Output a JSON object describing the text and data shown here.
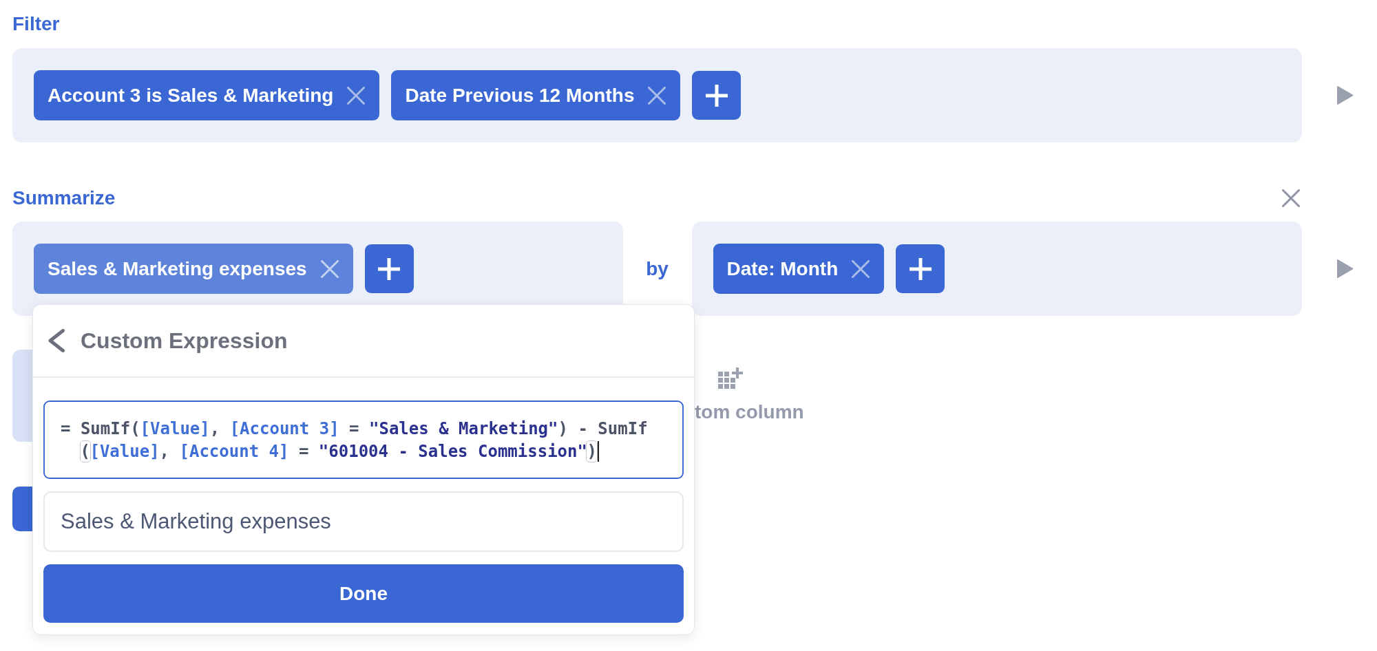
{
  "filter": {
    "title": "Filter",
    "chips": [
      {
        "label": "Account 3 is Sales & Marketing",
        "selected": false
      },
      {
        "label": "Date Previous 12 Months",
        "selected": false
      }
    ]
  },
  "summarize": {
    "title": "Summarize",
    "metrics": [
      {
        "label": "Sales & Marketing expenses",
        "selected": true
      }
    ],
    "by": "by",
    "breakouts": [
      {
        "label": "Date: Month",
        "selected": false
      }
    ]
  },
  "actions": {
    "custom_column": {
      "label": "tom column"
    }
  },
  "popup": {
    "title": "Custom Expression",
    "expression": {
      "focused": true,
      "cursor": true,
      "lines": [
        {
          "tokens": [
            {
              "text": "= ",
              "kind": "operator"
            },
            {
              "text": "SumIf",
              "kind": "function"
            },
            {
              "text": "(",
              "kind": "punct"
            },
            {
              "text": "[Value]",
              "kind": "field"
            },
            {
              "text": ", ",
              "kind": "punct"
            },
            {
              "text": "[Account 3]",
              "kind": "field"
            },
            {
              "text": " = ",
              "kind": "operator"
            },
            {
              "text": "\"Sales & Marketing\"",
              "kind": "string"
            },
            {
              "text": ")",
              "kind": "punct"
            },
            {
              "text": " - ",
              "kind": "operator"
            },
            {
              "text": "SumIf",
              "kind": "function"
            }
          ]
        },
        {
          "tokens": [
            {
              "text": "(",
              "kind": "match"
            },
            {
              "text": "[Value]",
              "kind": "field"
            },
            {
              "text": ", ",
              "kind": "punct"
            },
            {
              "text": "[Account 4]",
              "kind": "field"
            },
            {
              "text": " = ",
              "kind": "operator"
            },
            {
              "text": "\"601004 - Sales Commission\"",
              "kind": "string"
            },
            {
              "text": ")",
              "kind": "match"
            }
          ]
        }
      ]
    },
    "name_field": {
      "value": "Sales & Marketing expenses"
    },
    "done_button": {
      "label": "Done"
    }
  }
}
